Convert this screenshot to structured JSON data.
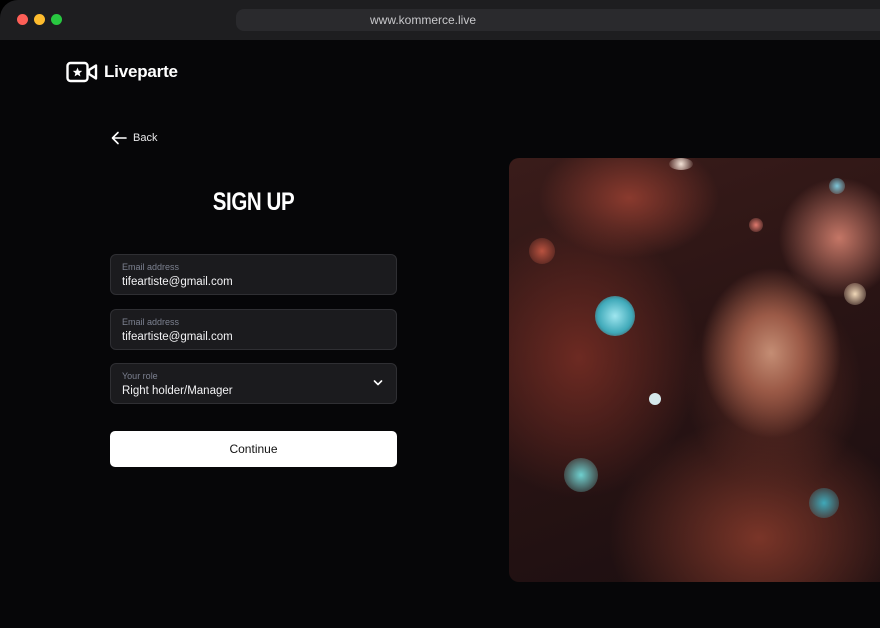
{
  "browser": {
    "url": "www.kommerce.live"
  },
  "brand": {
    "name": "Liveparte"
  },
  "nav": {
    "back_label": "Back"
  },
  "form": {
    "title": "SIGN UP",
    "fields": [
      {
        "label": "Email address",
        "value": "tifeartiste@gmail.com"
      },
      {
        "label": "Email address",
        "value": "tifeartiste@gmail.com"
      },
      {
        "label": "Your role",
        "value": "Right holder/Manager"
      }
    ],
    "continue_label": "Continue"
  },
  "colors": {
    "background": "#060608",
    "field_bg": "#1b1b1e",
    "button_bg": "#ffffff",
    "traffic_red": "#fe5f57",
    "traffic_yellow": "#febc2e",
    "traffic_green": "#28c840"
  },
  "icons": [
    "video-camera-star-icon",
    "arrow-left-icon",
    "chevron-down-icon"
  ]
}
